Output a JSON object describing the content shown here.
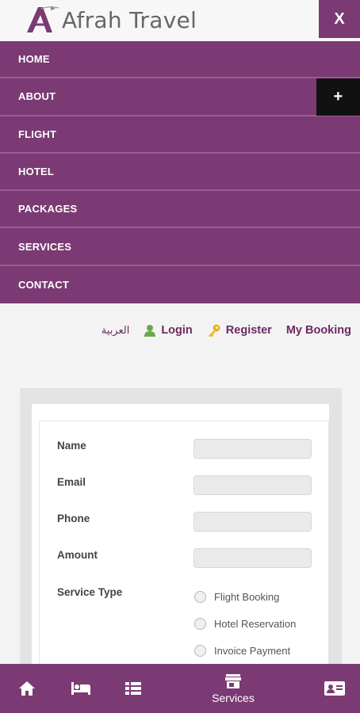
{
  "brand": {
    "name": "Afrah Travel",
    "color": "#7b3a73"
  },
  "header": {
    "close_label": "X"
  },
  "menu": {
    "items": [
      {
        "label": "HOME"
      },
      {
        "label": "ABOUT",
        "expand_label": "+"
      },
      {
        "label": "FLIGHT"
      },
      {
        "label": "HOTEL"
      },
      {
        "label": "PACKAGES"
      },
      {
        "label": "SERVICES"
      },
      {
        "label": "CONTACT"
      }
    ]
  },
  "toplinks": {
    "arabic": "العربية",
    "login": "Login",
    "register": "Register",
    "my_booking": "My Booking",
    "login_icon": "user-icon",
    "register_icon": "key-icon"
  },
  "form": {
    "fields": [
      {
        "label": "Name",
        "value": ""
      },
      {
        "label": "Email",
        "value": ""
      },
      {
        "label": "Phone",
        "value": ""
      },
      {
        "label": "Amount",
        "value": ""
      }
    ],
    "service_type": {
      "label": "Service Type",
      "options": [
        {
          "label": "Flight Booking",
          "selected": false
        },
        {
          "label": "Hotel Reservation",
          "selected": false
        },
        {
          "label": "Invoice Payment",
          "selected": false
        }
      ]
    }
  },
  "bottom_nav": {
    "items": [
      {
        "icon": "home-icon",
        "label": ""
      },
      {
        "icon": "bed-icon",
        "label": ""
      },
      {
        "icon": "list-icon",
        "label": ""
      },
      {
        "icon": "store-icon",
        "label": "Services",
        "active": true
      },
      {
        "icon": "contact-card-icon",
        "label": ""
      }
    ]
  }
}
